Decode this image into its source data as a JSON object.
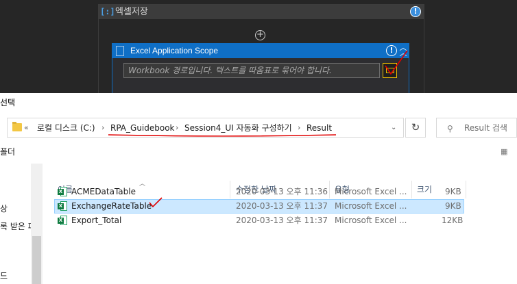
{
  "designer": {
    "sequence": {
      "title": "엑셀저장",
      "warning_icon": "warning-icon",
      "add_icon": "plus-circle-icon"
    },
    "scope": {
      "title": "Excel Application Scope",
      "input_placeholder": "Workbook 경로입니다. 텍스트를 따옴표로 묶어야 합니다.",
      "folder_icon": "folder-icon",
      "collapse_icon": "chevron-up-icon"
    },
    "colors": {
      "scope_header": "#0f6fc6",
      "dark_bg": "#262626",
      "highlight": "#f0c000"
    }
  },
  "dialog": {
    "title": "선택",
    "breadcrumb": {
      "overflow": "«",
      "items": [
        "로컬 디스크 (C:)",
        "RPA_Guidebook",
        "Session4_UI 자동화 구성하기",
        "Result"
      ]
    },
    "search_placeholder": "Result 검색",
    "toolbar_label": "폴더",
    "nav_items": [
      "상",
      "록 받은 파",
      "",
      "",
      "",
      "드"
    ],
    "columns": [
      "이름",
      "수정한 날짜",
      "유형",
      "크기"
    ],
    "files": [
      {
        "name": "ACMEDataTable",
        "modified": "2020-03-13 오후 11:36",
        "type": "Microsoft Excel ...",
        "size": "9KB",
        "selected": false
      },
      {
        "name": "ExchangeRateTable",
        "modified": "2020-03-13 오후 11:37",
        "type": "Microsoft Excel ...",
        "size": "9KB",
        "selected": true
      },
      {
        "name": "Export_Total",
        "modified": "2020-03-13 오후 11:37",
        "type": "Microsoft Excel ...",
        "size": "12KB",
        "selected": false
      }
    ],
    "colors": {
      "selection": "#cce8ff",
      "annotation": "#e00000"
    }
  }
}
